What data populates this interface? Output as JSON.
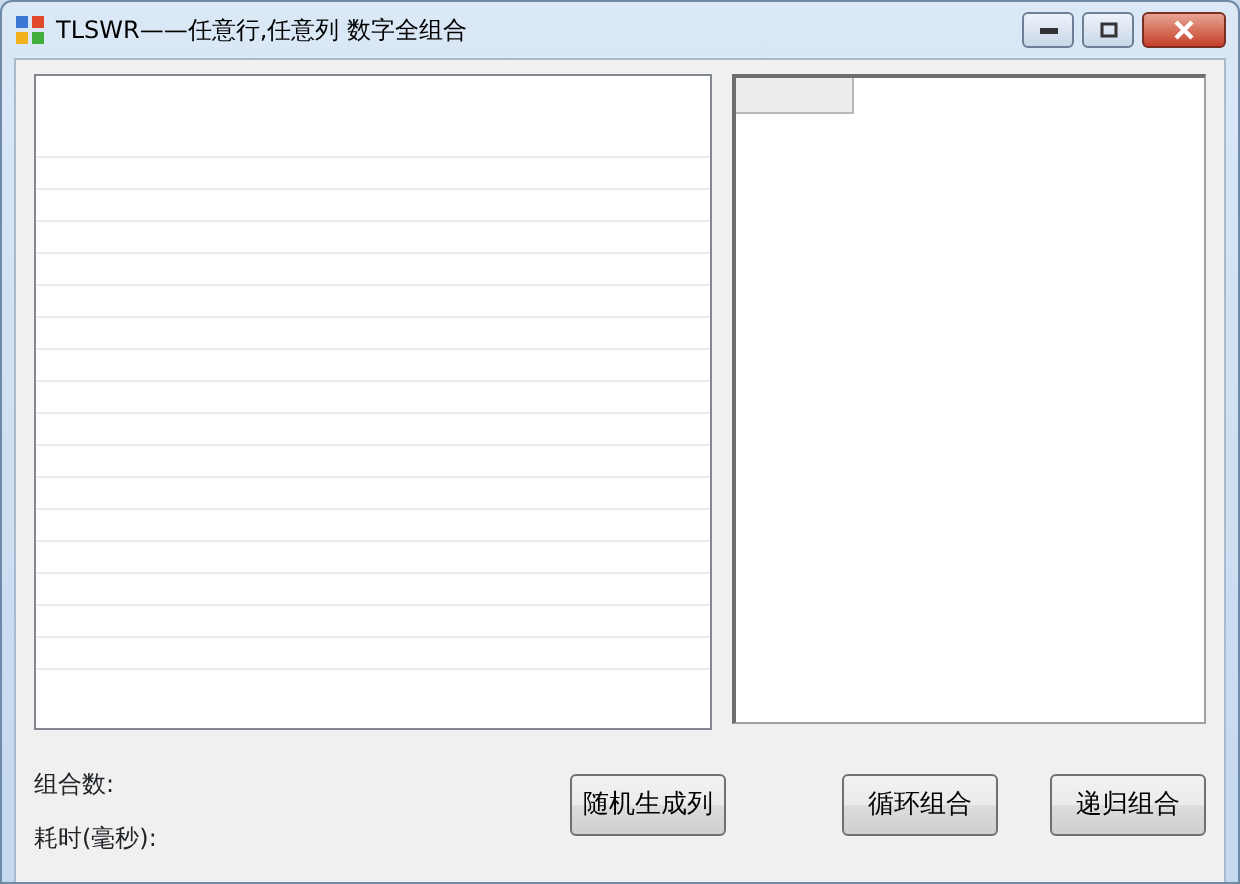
{
  "window": {
    "title": "TLSWR——任意行,任意列 数字全组合"
  },
  "labels": [
    "组合数:",
    "耗时(毫秒):"
  ],
  "buttons": [
    "随机生成列",
    "循环组合",
    "递归组合"
  ]
}
